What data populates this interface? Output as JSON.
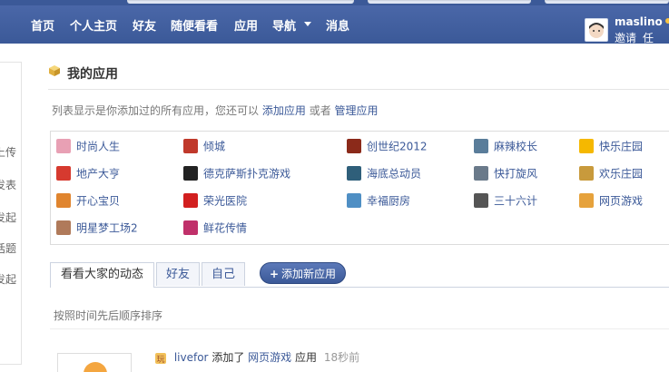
{
  "nav": {
    "items": [
      "首页",
      "个人主页",
      "好友",
      "随便看看",
      "应用",
      "导航",
      "消息"
    ],
    "user_name": "maslino",
    "user_links": [
      "邀请",
      "任务"
    ]
  },
  "left_sidebar": {
    "items": [
      "上传",
      "发表",
      "发起",
      "话题",
      "发起"
    ]
  },
  "page": {
    "title": "我的应用",
    "desc_prefix": "列表显示是你添加过的所有应用，您还可以",
    "desc_link_add": "添加应用",
    "desc_or": "或者",
    "desc_link_manage": "管理应用"
  },
  "apps": [
    {
      "label": "时尚人生",
      "icon": "fashion-girl-icon",
      "color": "#e8a0b4"
    },
    {
      "label": "倾城",
      "icon": "qingcheng-icon",
      "color": "#c0392b"
    },
    {
      "label": "创世纪2012",
      "icon": "genesis-icon",
      "color": "#8b2a1a"
    },
    {
      "label": "麻辣校长",
      "icon": "school-house-icon",
      "color": "#5a7d9a"
    },
    {
      "label": "快乐庄园",
      "icon": "chick-icon",
      "color": "#f5b800"
    },
    {
      "label": "地产大亨",
      "icon": "realestate-icon",
      "color": "#d63a2f"
    },
    {
      "label": "德克萨斯扑克游戏",
      "icon": "poker-chip-icon",
      "color": "#222222"
    },
    {
      "label": "海底总动员",
      "icon": "sea-icon",
      "color": "#2f5f7a"
    },
    {
      "label": "快打旋风",
      "icon": "fighter-icon",
      "color": "#6a7a8a"
    },
    {
      "label": "欢乐庄园",
      "icon": "farm-icon",
      "color": "#c89a3c"
    },
    {
      "label": "开心宝贝",
      "icon": "happy-baby-icon",
      "color": "#e0852f"
    },
    {
      "label": "荣光医院",
      "icon": "hospital-cross-icon",
      "color": "#d21f1f"
    },
    {
      "label": "幸福厨房",
      "icon": "kitchen-icon",
      "color": "#4f8fc4"
    },
    {
      "label": "三十六计",
      "icon": "strategy-icon",
      "color": "#555555"
    },
    {
      "label": "网页游戏",
      "icon": "webgame-icon",
      "color": "#e6a23c"
    },
    {
      "label": "明星梦工场2",
      "icon": "star-girl-icon",
      "color": "#b07a5a"
    },
    {
      "label": "鲜花传情",
      "icon": "flower-icon",
      "color": "#c0306a"
    }
  ],
  "tabs": [
    "看看大家的动态",
    "好友",
    "自己"
  ],
  "add_app_button": "添加新应用",
  "sort_note": "按照时间先后顺序排序",
  "feed": {
    "user": "livefor",
    "verb": "添加了",
    "app": "网页游戏",
    "suffix": "应用",
    "time": "18秒前"
  }
}
